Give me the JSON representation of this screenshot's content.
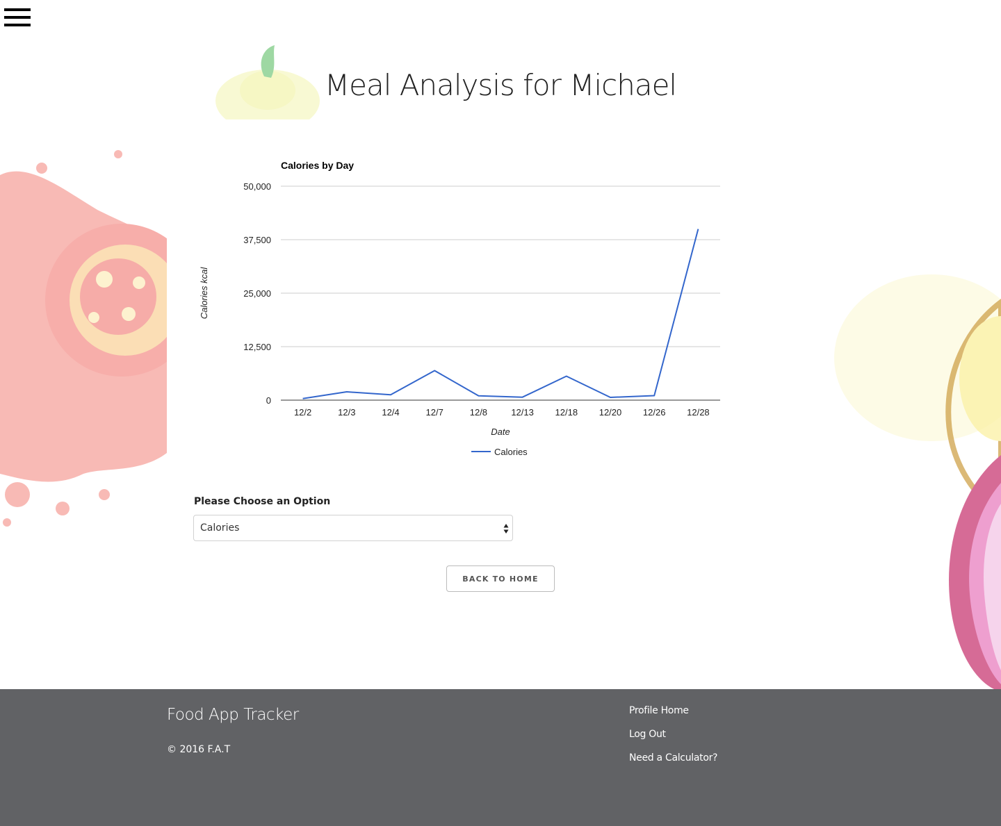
{
  "header": {
    "title": "Meal Analysis for Michael"
  },
  "chart_data": {
    "type": "line",
    "title": "Calories by Day",
    "xlabel": "Date",
    "ylabel": "Calories kcal",
    "categories": [
      "12/2",
      "12/3",
      "12/4",
      "12/7",
      "12/8",
      "12/13",
      "12/18",
      "12/20",
      "12/26",
      "12/28"
    ],
    "series": [
      {
        "name": "Calories",
        "color": "#3366cc",
        "values": [
          350,
          1950,
          1250,
          6900,
          1000,
          700,
          5600,
          650,
          1050,
          40000
        ]
      }
    ],
    "yticks": [
      "0",
      "12,500",
      "25,000",
      "37,500",
      "50,000"
    ],
    "ylim": [
      0,
      50000
    ],
    "grid": true,
    "legend": "bottom"
  },
  "form": {
    "select_label": "Please Choose an Option",
    "select_value": "Calories"
  },
  "actions": {
    "back_label": "BACK TO HOME"
  },
  "footer": {
    "brand": "Food App Tracker",
    "copyright": "© 2016 F.A.T",
    "links": [
      "Profile Home",
      "Log Out",
      "Need a Calculator?"
    ],
    "background": "#616265"
  },
  "icons": {
    "menu": "hamburger-menu-icon",
    "select_arrows": "select-arrows-icon"
  }
}
